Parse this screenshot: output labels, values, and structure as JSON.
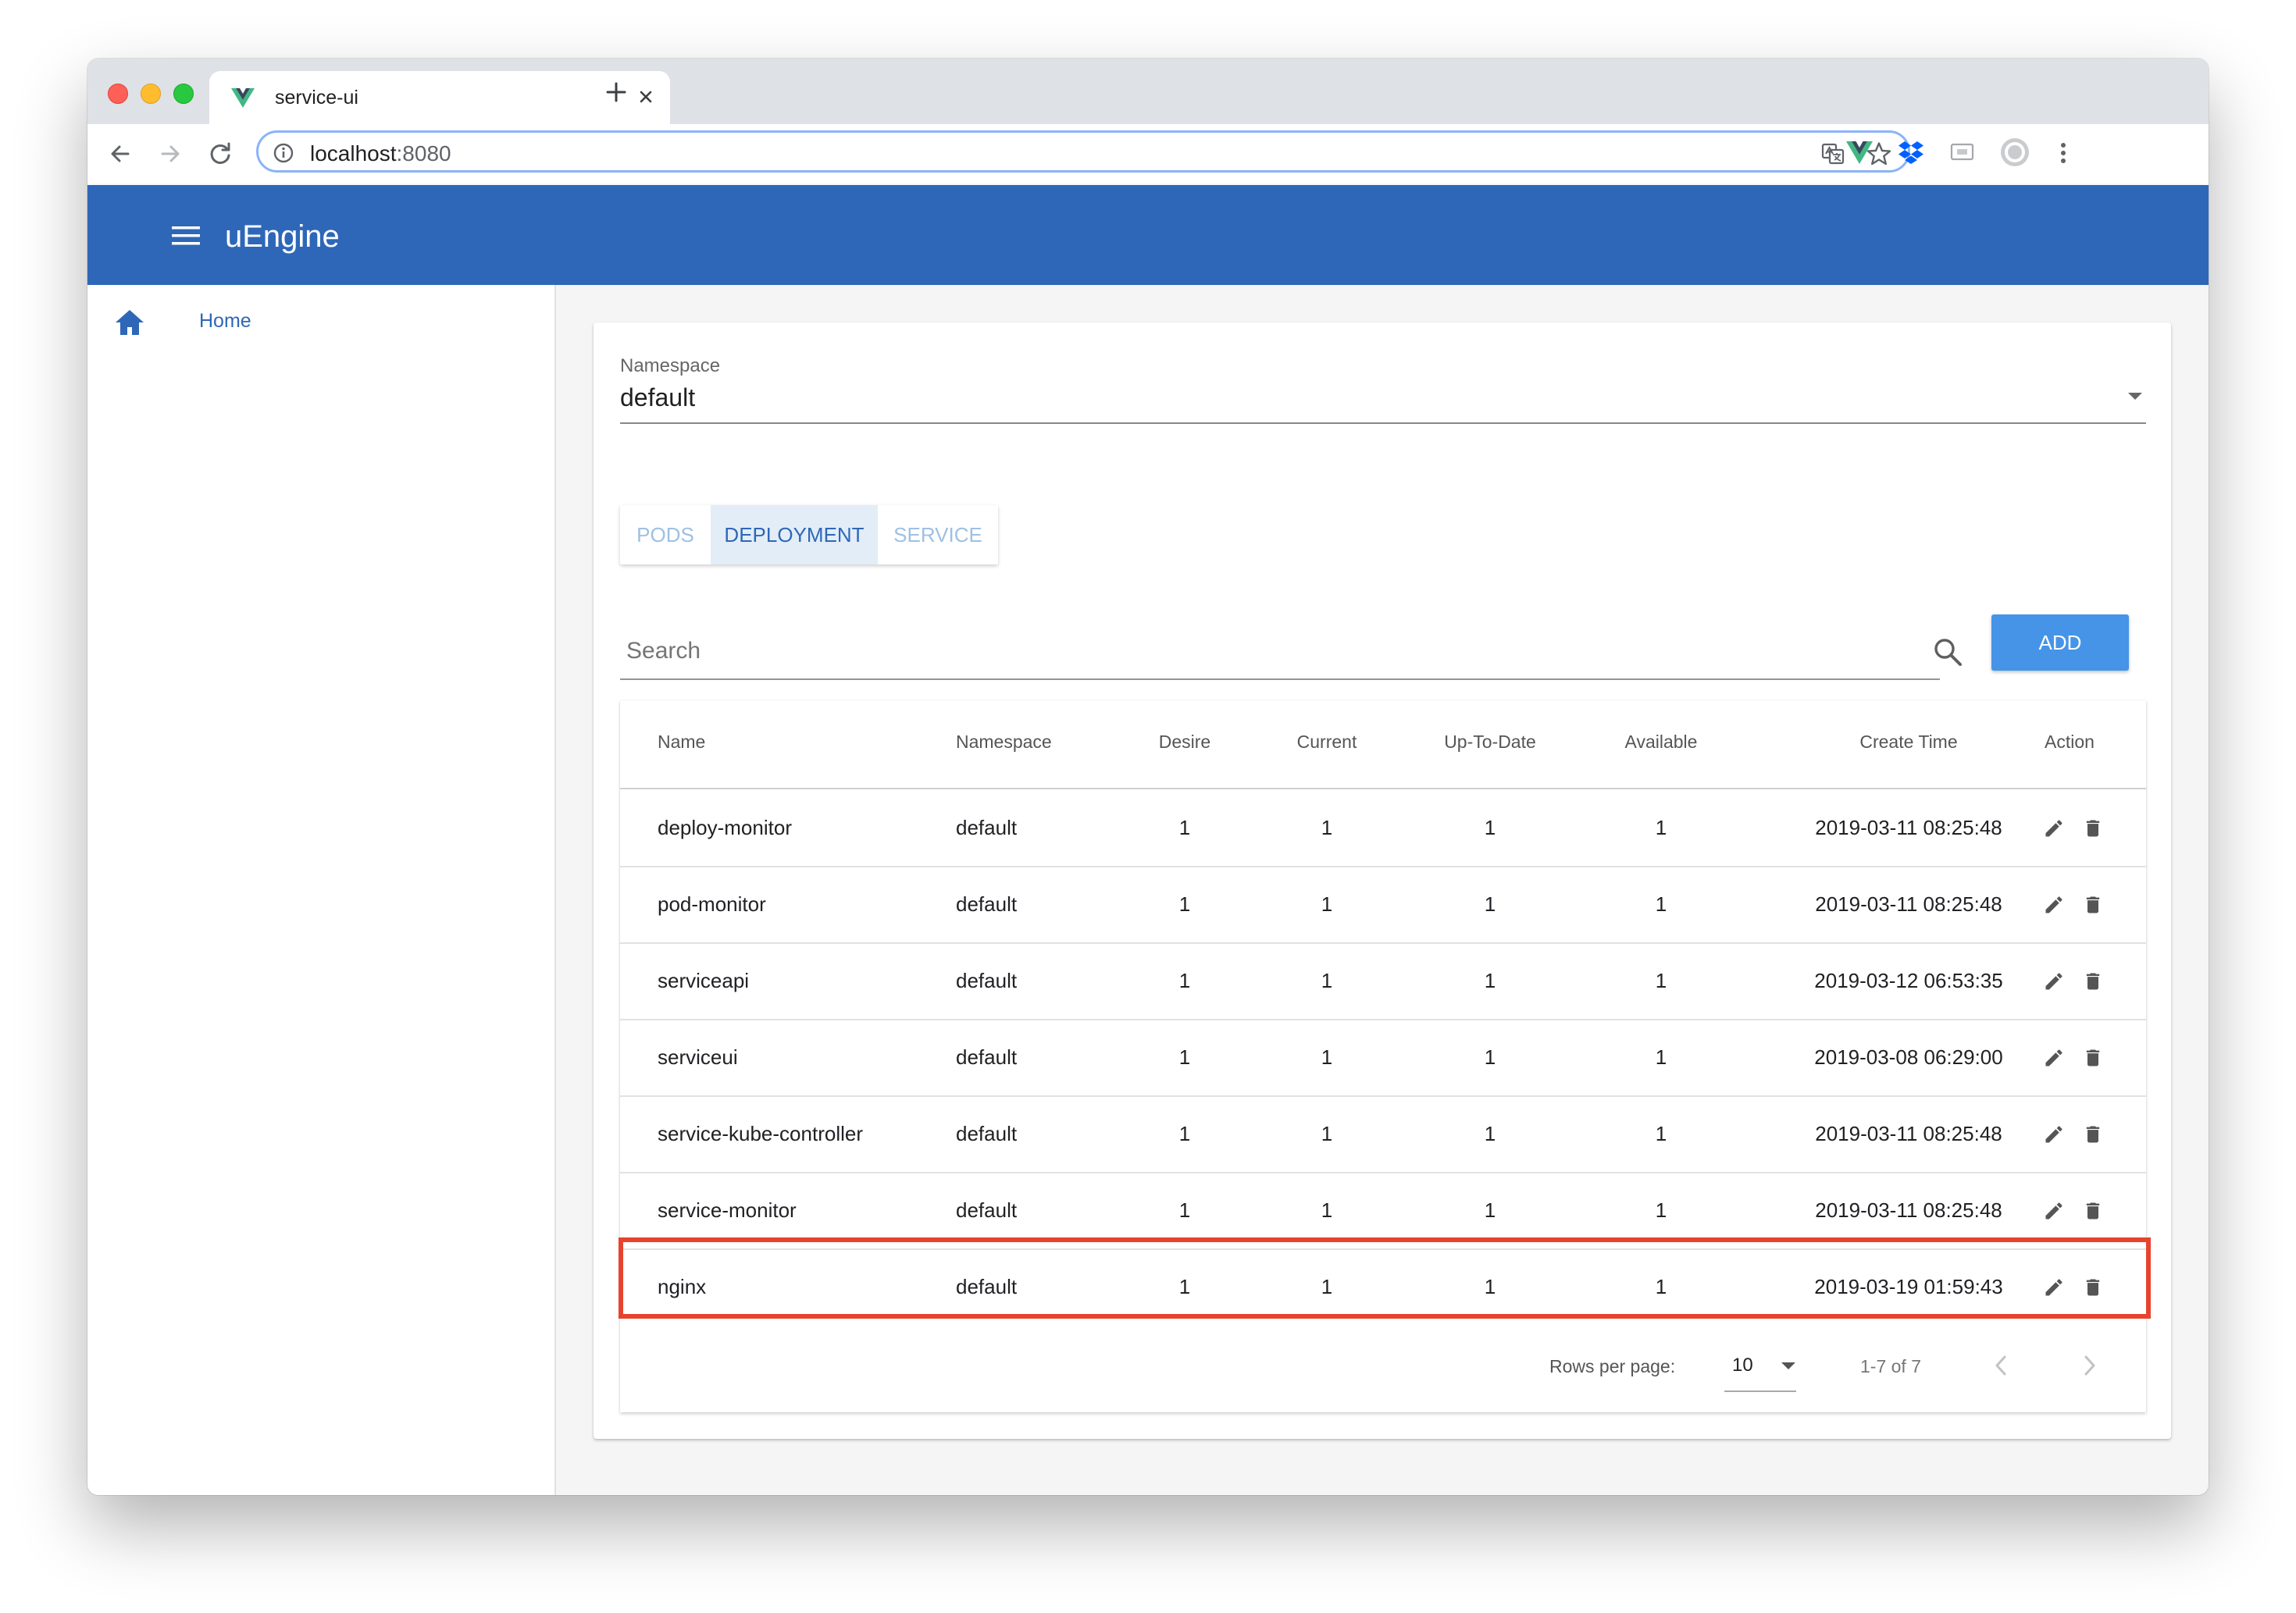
{
  "browser": {
    "tab_title": "service-ui",
    "url_host": "localhost",
    "url_port": ":8080"
  },
  "app": {
    "title": "uEngine",
    "accent_color": "#2e67b8"
  },
  "sidebar": {
    "items": [
      {
        "label": "Home",
        "icon": "home-icon"
      }
    ]
  },
  "namespace": {
    "label": "Namespace",
    "value": "default"
  },
  "tabs": [
    {
      "label": "PODS",
      "active": false
    },
    {
      "label": "DEPLOYMENT",
      "active": true
    },
    {
      "label": "SERVICE",
      "active": false
    }
  ],
  "search": {
    "placeholder": "Search"
  },
  "add_button": {
    "label": "ADD",
    "color": "#4594e8"
  },
  "table": {
    "columns": [
      "Name",
      "Namespace",
      "Desire",
      "Current",
      "Up-To-Date",
      "Available",
      "Create Time",
      "Action"
    ],
    "rows": [
      {
        "name": "deploy-monitor",
        "namespace": "default",
        "desire": "1",
        "current": "1",
        "uptodate": "1",
        "available": "1",
        "create_time": "2019-03-11 08:25:48"
      },
      {
        "name": "pod-monitor",
        "namespace": "default",
        "desire": "1",
        "current": "1",
        "uptodate": "1",
        "available": "1",
        "create_time": "2019-03-11 08:25:48"
      },
      {
        "name": "serviceapi",
        "namespace": "default",
        "desire": "1",
        "current": "1",
        "uptodate": "1",
        "available": "1",
        "create_time": "2019-03-12 06:53:35"
      },
      {
        "name": "serviceui",
        "namespace": "default",
        "desire": "1",
        "current": "1",
        "uptodate": "1",
        "available": "1",
        "create_time": "2019-03-08 06:29:00"
      },
      {
        "name": "service-kube-controller",
        "namespace": "default",
        "desire": "1",
        "current": "1",
        "uptodate": "1",
        "available": "1",
        "create_time": "2019-03-11 08:25:48"
      },
      {
        "name": "service-monitor",
        "namespace": "default",
        "desire": "1",
        "current": "1",
        "uptodate": "1",
        "available": "1",
        "create_time": "2019-03-11 08:25:48"
      },
      {
        "name": "nginx",
        "namespace": "default",
        "desire": "1",
        "current": "1",
        "uptodate": "1",
        "available": "1",
        "create_time": "2019-03-19 01:59:43",
        "highlighted": true
      }
    ],
    "highlight_color": "#e8432d"
  },
  "pagination": {
    "rows_per_page_label": "Rows per page:",
    "rows_per_page": "10",
    "range": "1-7 of 7"
  }
}
